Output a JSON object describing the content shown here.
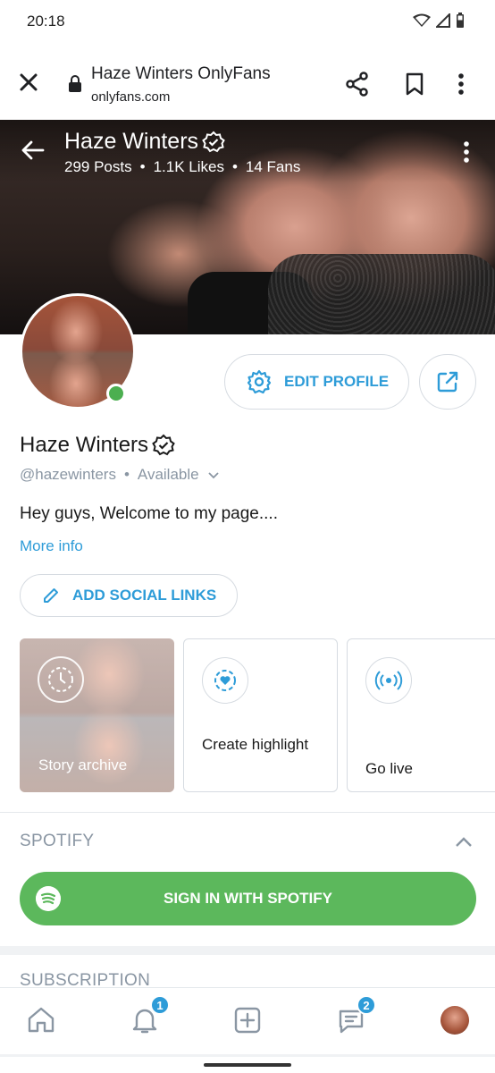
{
  "status_bar": {
    "time": "20:18"
  },
  "browser": {
    "title": "Haze Winters OnlyFans",
    "url": "onlyfans.com"
  },
  "cover": {
    "name": "Haze Winters",
    "stats": {
      "posts": "299 Posts",
      "likes": "1.1K Likes",
      "fans": "14 Fans"
    }
  },
  "actions": {
    "edit_profile": "EDIT PROFILE"
  },
  "profile": {
    "name": "Haze Winters",
    "handle": "@hazewinters",
    "availability": "Available",
    "bio": "Hey guys, Welcome to my page....",
    "more_info": "More info",
    "add_social": "ADD SOCIAL LINKS"
  },
  "highlights": [
    {
      "label": "Story archive"
    },
    {
      "label": "Create highlight"
    },
    {
      "label": "Go live"
    }
  ],
  "spotify": {
    "section_title": "SPOTIFY",
    "sign_in": "SIGN IN WITH SPOTIFY"
  },
  "subscription": {
    "title": "SUBSCRIPTION"
  },
  "bottom_nav": {
    "notifications_badge": "1",
    "messages_badge": "2"
  },
  "colors": {
    "accent": "#2e9cd8",
    "spotify": "#5cb85c",
    "online": "#4caf50",
    "muted": "#8a96a3"
  }
}
